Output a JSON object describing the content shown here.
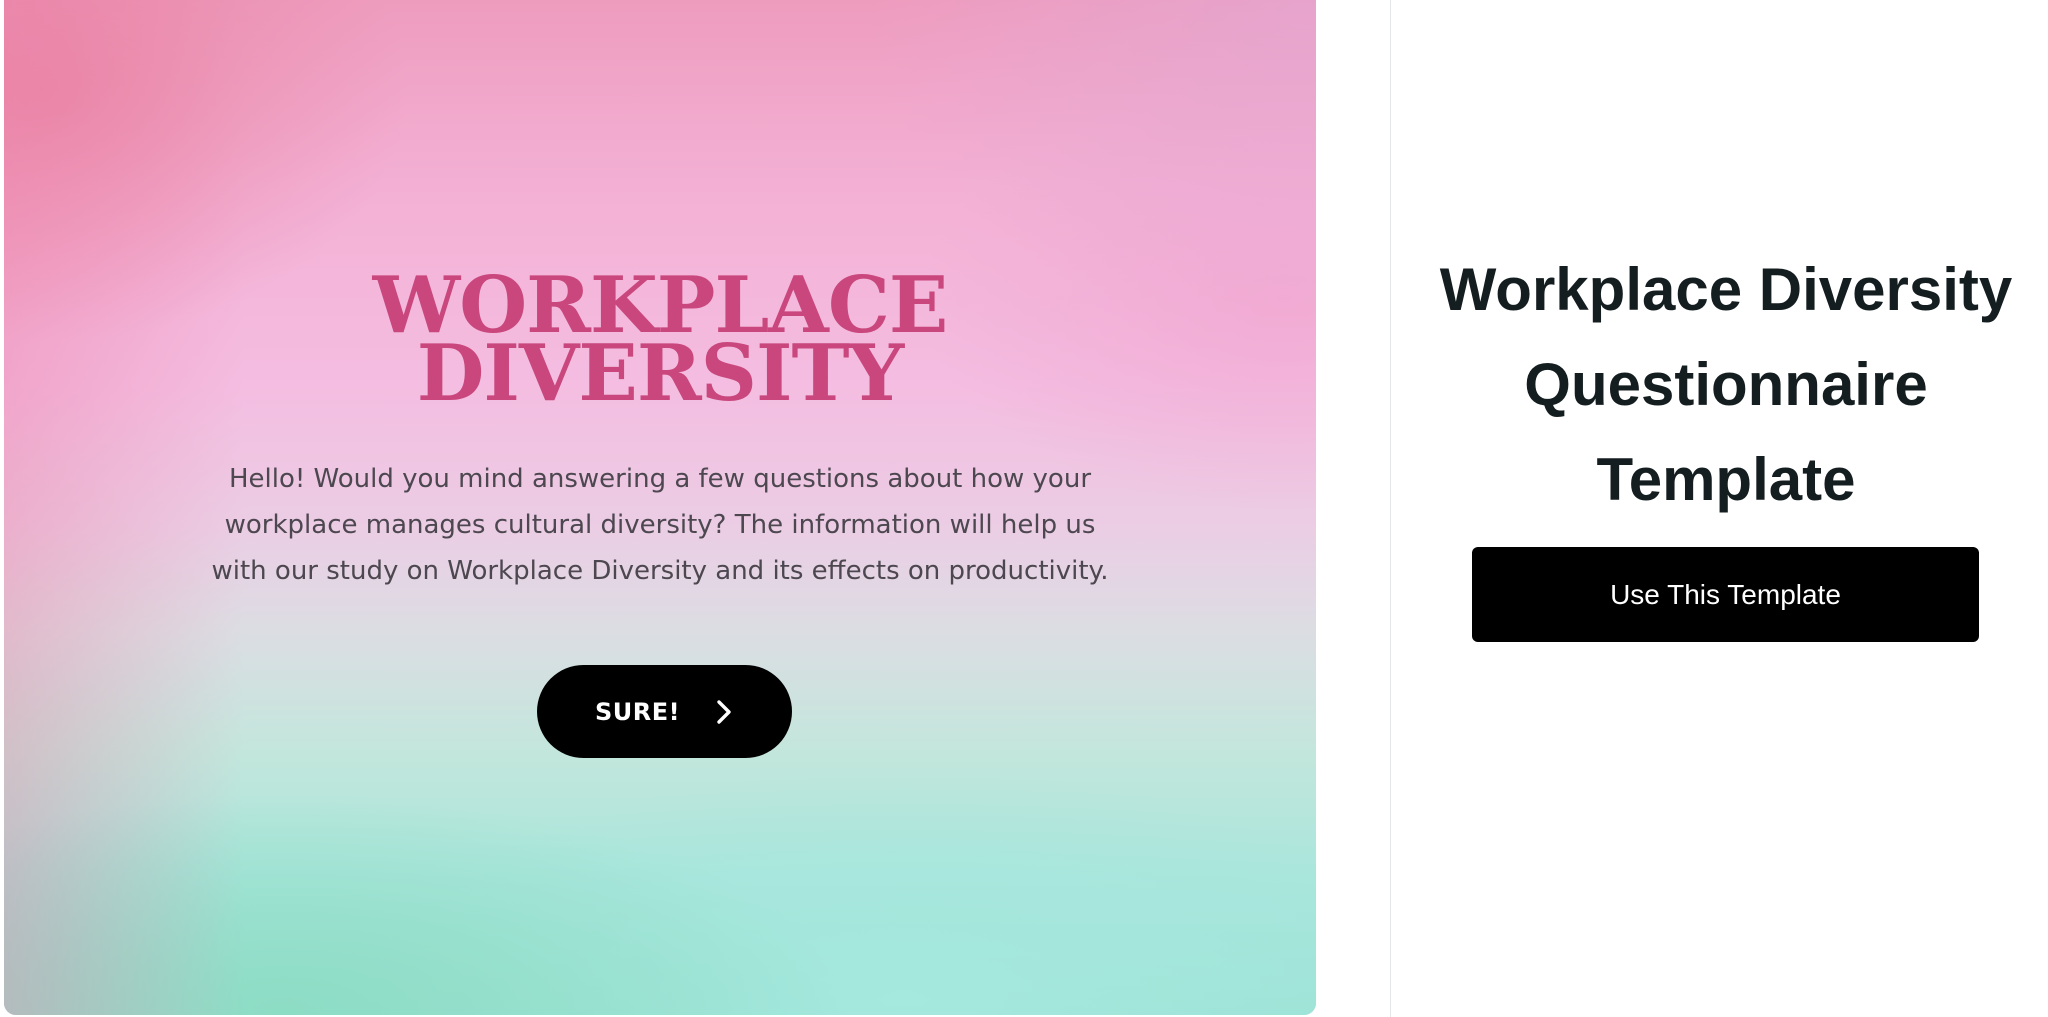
{
  "preview": {
    "title": "WORKPLACE\nDIVERSITY",
    "description": "Hello! Would you mind answering a few questions about how your workplace manages cultural diversity? The information will help us with our study on Workplace Diversity and its effects on productivity.",
    "button_label": "SURE!",
    "button_icon": "chevron-right-icon",
    "title_color": "#c9477d"
  },
  "side": {
    "title": "Workplace Diversity Questionnaire Template",
    "cta_label": "Use This Template"
  }
}
